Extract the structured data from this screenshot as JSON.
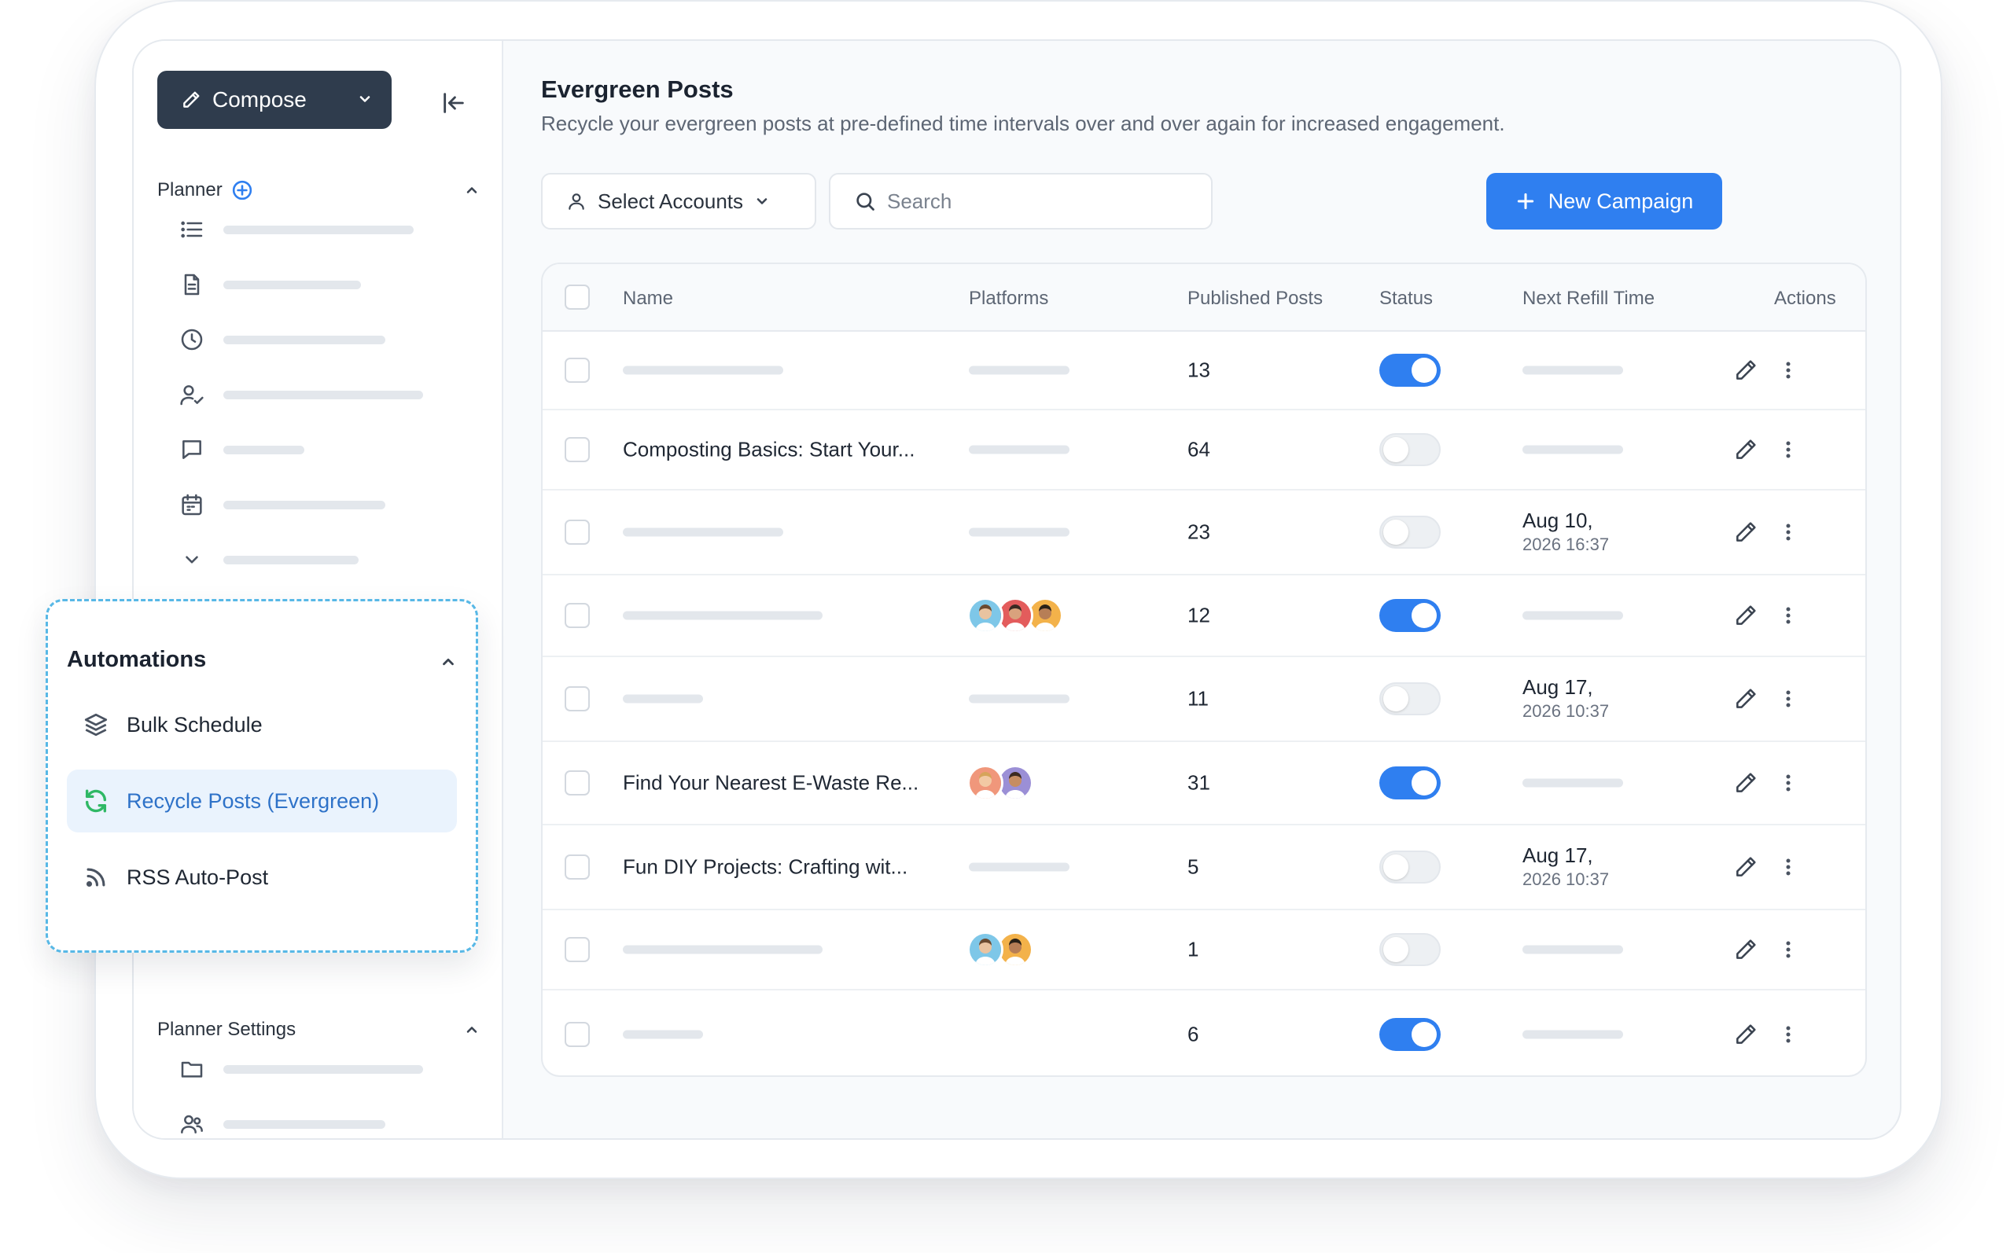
{
  "sidebar": {
    "compose_label": "Compose",
    "planner_label": "Planner",
    "planner_settings_label": "Planner Settings"
  },
  "automations": {
    "title": "Automations",
    "items": [
      {
        "label": "Bulk Schedule",
        "icon": "layers-icon"
      },
      {
        "label": "Recycle Posts (Evergreen)",
        "icon": "recycle-icon",
        "active": true
      },
      {
        "label": "RSS Auto-Post",
        "icon": "rss-icon"
      }
    ]
  },
  "main": {
    "title": "Evergreen Posts",
    "subtitle": "Recycle your evergreen posts at pre-defined time intervals over and over again for increased engagement.",
    "select_accounts_label": "Select Accounts",
    "search_placeholder": "Search",
    "new_campaign_label": "New Campaign"
  },
  "table": {
    "columns": [
      "Name",
      "Platforms",
      "Published Posts",
      "Status",
      "Next Refill Time",
      "Actions"
    ],
    "rows": [
      {
        "name": "",
        "platforms": [],
        "published": "13",
        "status": "on",
        "refill_date": "",
        "refill_time": ""
      },
      {
        "name": "Composting Basics: Start Your...",
        "platforms": [],
        "published": "64",
        "status": "off",
        "refill_date": "",
        "refill_time": ""
      },
      {
        "name": "",
        "platforms": [],
        "published": "23",
        "status": "off",
        "refill_date": "Aug 10,",
        "refill_time": "2026 16:37"
      },
      {
        "name": "",
        "platforms": [
          "avatar-1",
          "avatar-2",
          "avatar-3"
        ],
        "published": "12",
        "status": "on",
        "refill_date": "",
        "refill_time": ""
      },
      {
        "name": "",
        "platforms": [],
        "published": "11",
        "status": "off",
        "refill_date": "Aug 17,",
        "refill_time": "2026 10:37"
      },
      {
        "name": "Find Your Nearest E-Waste Re...",
        "platforms": [
          "avatar-4",
          "avatar-5"
        ],
        "published": "31",
        "status": "on",
        "refill_date": "",
        "refill_time": ""
      },
      {
        "name": "Fun DIY Projects: Crafting wit...",
        "platforms": [],
        "published": "5",
        "status": "off",
        "refill_date": "Aug 17,",
        "refill_time": "2026 10:37"
      },
      {
        "name": "",
        "platforms": [
          "avatar-1",
          "avatar-3"
        ],
        "published": "1",
        "status": "off",
        "refill_date": "",
        "refill_time": ""
      },
      {
        "name": "",
        "platforms": [],
        "published": "6",
        "status": "on",
        "refill_date": "",
        "refill_time": ""
      }
    ]
  },
  "colors": {
    "accent": "#2f7ff0",
    "compose_bg": "#2f3c4d",
    "highlight_border": "#58b8e6",
    "active_item_text": "#2e72c8",
    "recycle_icon": "#2fb865"
  }
}
